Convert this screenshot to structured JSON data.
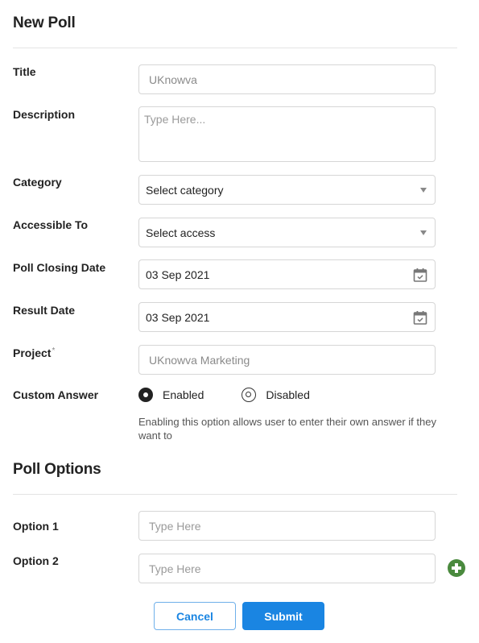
{
  "header": {
    "title": "New Poll"
  },
  "form": {
    "title": {
      "label": "Title",
      "value": "UKnowva"
    },
    "description": {
      "label": "Description",
      "placeholder": "Type Here..."
    },
    "category": {
      "label": "Category",
      "selected": "Select category",
      "icon": "chevron-down-icon"
    },
    "accessible_to": {
      "label": "Accessible To",
      "selected": "Select access",
      "icon": "chevron-down-icon"
    },
    "poll_closing_date": {
      "label": "Poll Closing Date",
      "value": "03 Sep 2021",
      "icon": "calendar-check-icon"
    },
    "result_date": {
      "label": "Result Date",
      "value": "03 Sep 2021",
      "icon": "calendar-check-icon"
    },
    "project": {
      "label": "Project",
      "required_mark": "*",
      "value": "UKnowva Marketing"
    },
    "custom_answer": {
      "label": "Custom Answer",
      "options": [
        {
          "label": "Enabled",
          "checked": true
        },
        {
          "label": "Disabled",
          "checked": false
        }
      ],
      "hint": "Enabling this option allows  user to enter their own answer if they want to"
    }
  },
  "poll_options": {
    "title": "Poll Options",
    "items": [
      {
        "label": "Option 1",
        "placeholder": "Type Here"
      },
      {
        "label": "Option 2",
        "placeholder": "Type Here"
      }
    ],
    "add_icon": "plus-circle-icon",
    "add_color": "#4a8a3e"
  },
  "actions": {
    "cancel_label": "Cancel",
    "submit_label": "Submit",
    "accent_color": "#1a85e2"
  }
}
